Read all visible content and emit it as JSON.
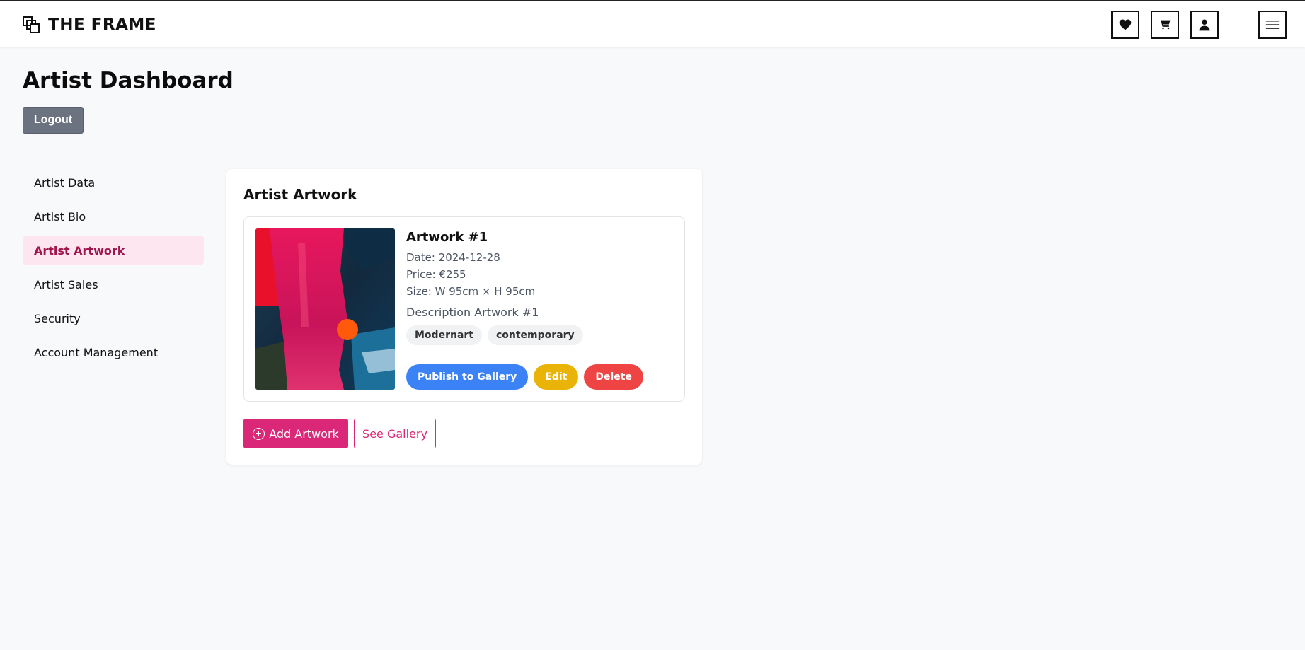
{
  "header": {
    "brand": "THE FRAME",
    "icons": [
      "heart-icon",
      "cart-icon",
      "user-icon",
      "menu-icon"
    ]
  },
  "page": {
    "title": "Artist Dashboard",
    "logout_label": "Logout"
  },
  "sidebar": {
    "items": [
      {
        "label": "Artist Data",
        "active": false
      },
      {
        "label": "Artist Bio",
        "active": false
      },
      {
        "label": "Artist Artwork",
        "active": true
      },
      {
        "label": "Artist Sales",
        "active": false
      },
      {
        "label": "Security",
        "active": false
      },
      {
        "label": "Account Management",
        "active": false
      }
    ]
  },
  "artwork_panel": {
    "title": "Artist Artwork",
    "artworks": [
      {
        "title": "Artwork #1",
        "date": "Date: 2024-12-28",
        "price": "Price: €255",
        "size": "Size: W 95cm × H 95cm",
        "description": "Description Artwork #1",
        "tags": [
          "Modernart",
          "contemporary"
        ],
        "actions": {
          "publish": "Publish to Gallery",
          "edit": "Edit",
          "delete": "Delete"
        }
      }
    ],
    "add_label": "Add Artwork",
    "gallery_label": "See Gallery"
  },
  "colors": {
    "accent": "#db2777",
    "active_bg": "#fde6ef",
    "active_text": "#a1154d",
    "publish": "#3b82f6",
    "edit": "#eab308",
    "delete": "#ef4444",
    "logout": "#6b7280"
  }
}
